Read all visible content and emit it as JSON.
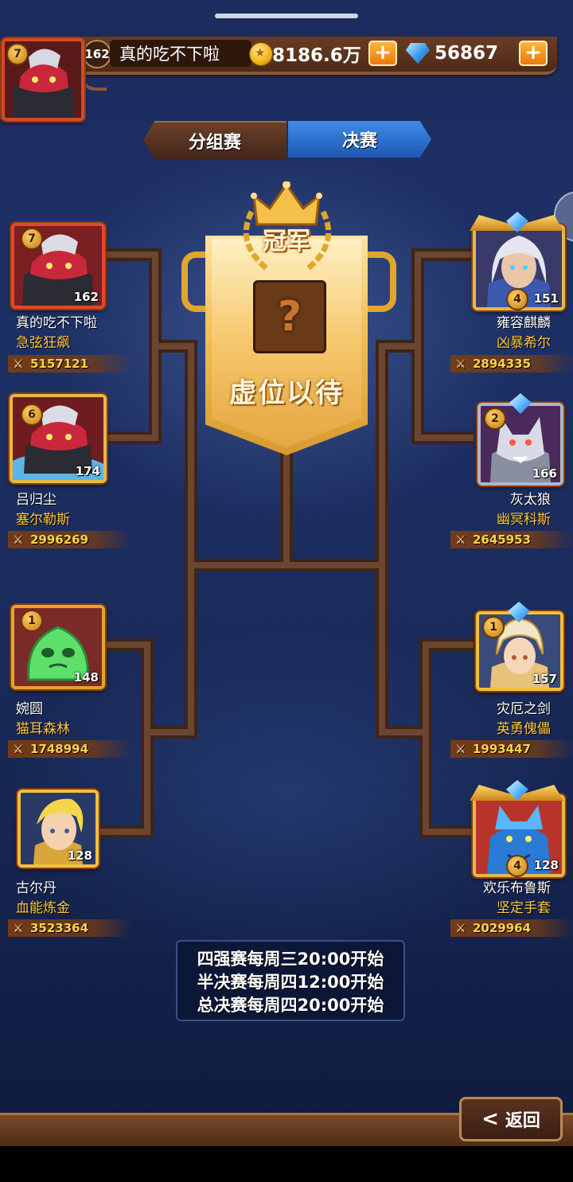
{
  "topbar": {
    "player_level": "162",
    "player_name": "真的吃不下啦",
    "player_star": "7",
    "gold": "8186.6万",
    "gems": "56867",
    "plus": "+"
  },
  "tabs": [
    {
      "label": "分组赛",
      "active": false
    },
    {
      "label": "决赛",
      "active": true
    }
  ],
  "champion": {
    "title": "冠军",
    "mystery": "?",
    "status": "虚位以待"
  },
  "left_players": [
    {
      "star": "7",
      "level": "162",
      "name": "真的吃不下啦",
      "guild": "急弦狂飙",
      "power": "5157121",
      "icon": "red-masked-hero-avatar"
    },
    {
      "star": "6",
      "level": "174",
      "name": "吕归尘",
      "guild": "塞尔勒斯",
      "power": "2996269",
      "icon": "red-masked-hero-avatar"
    },
    {
      "star": "1",
      "level": "148",
      "name": "婉圆",
      "guild": "猫耳森林",
      "power": "1748994",
      "icon": "green-slime-avatar"
    },
    {
      "star": "",
      "level": "128",
      "name": "古尔丹",
      "guild": "血能炼金",
      "power": "3523364",
      "icon": "blond-knight-avatar"
    }
  ],
  "right_players": [
    {
      "star": "4",
      "level": "151",
      "name": "雍容麒麟",
      "guild": "凶暴希尔",
      "power": "2894335",
      "icon": "silver-haired-warrior-avatar"
    },
    {
      "star": "2",
      "level": "166",
      "name": "灰太狼",
      "guild": "幽冥科斯",
      "power": "2645953",
      "icon": "gray-wolf-avatar"
    },
    {
      "star": "1",
      "level": "157",
      "name": "灾厄之剑",
      "guild": "英勇傀儡",
      "power": "1993447",
      "icon": "golden-helmet-maiden-avatar"
    },
    {
      "star": "4",
      "level": "128",
      "name": "欢乐布鲁斯",
      "guild": "坚定手套",
      "power": "2029964",
      "icon": "blue-dragon-avatar"
    }
  ],
  "schedule": [
    "四强赛每周三20:00开始",
    "半决赛每周四12:00开始",
    "总决赛每周四20:00开始"
  ],
  "back_label": "返回",
  "colors": {
    "accent_gold": "#ffc93a",
    "tab_active": "#2f74d2",
    "bracket_line": "#5a3a2a"
  }
}
